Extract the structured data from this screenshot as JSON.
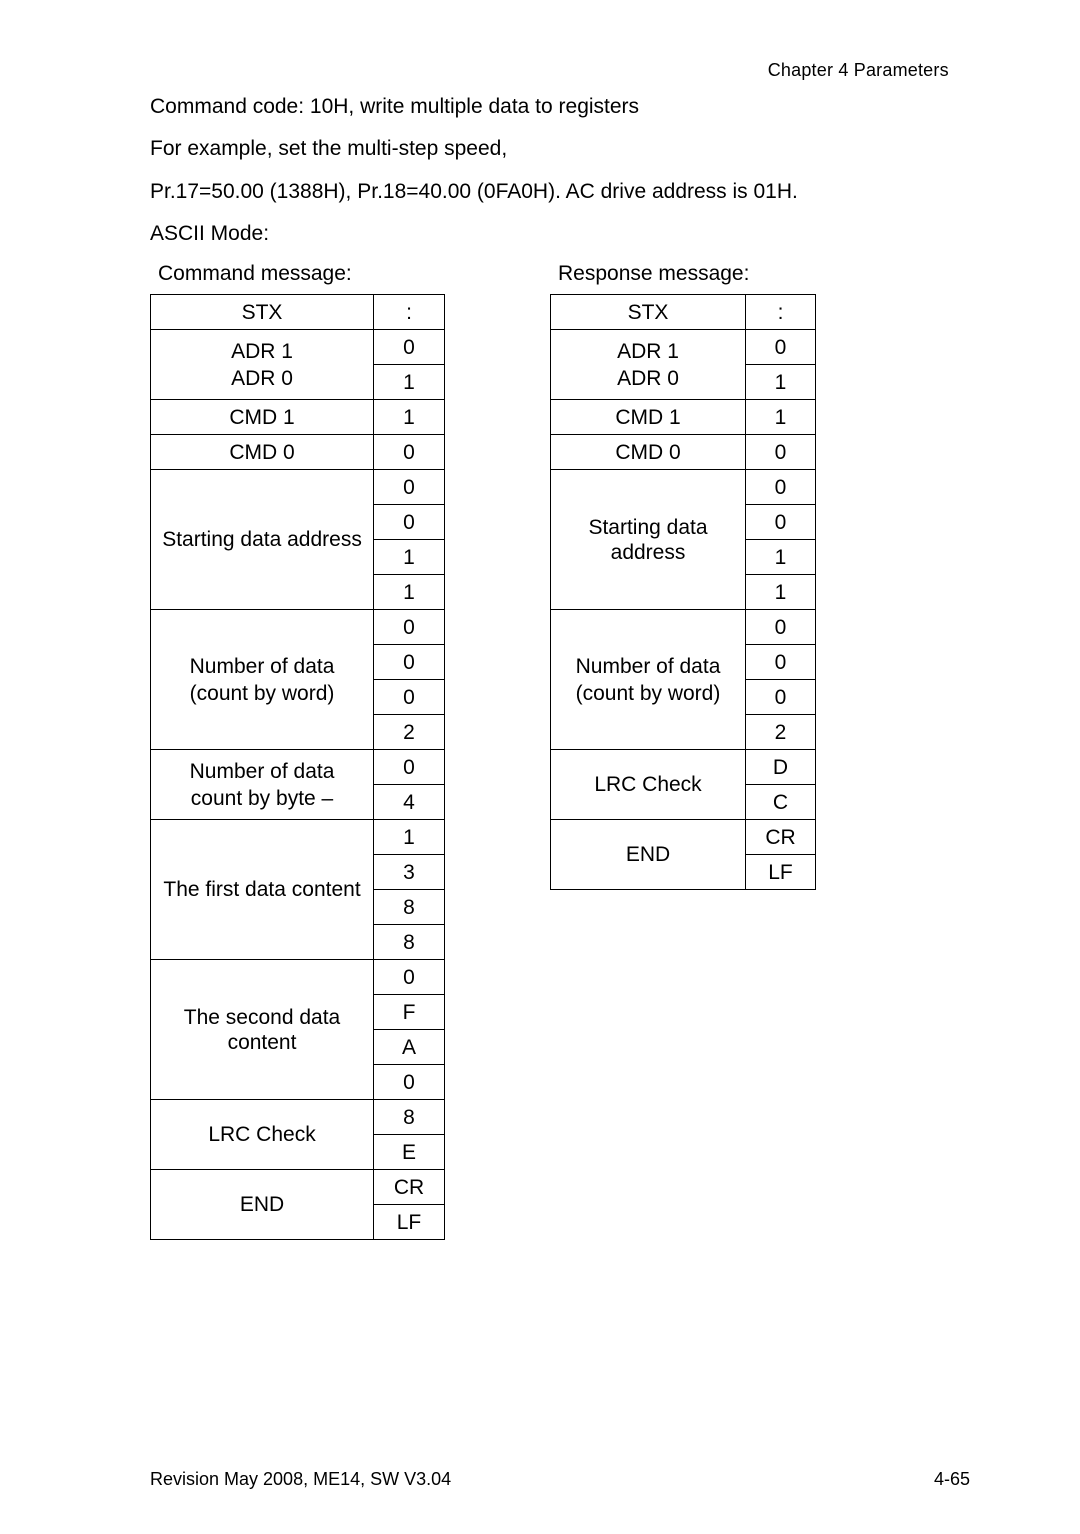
{
  "header": {
    "chapter": "Chapter 4 Parameters "
  },
  "intro": {
    "p1": "Command code: 10H, write multiple data to registers",
    "p2": "For example, set the multi-step speed,",
    "p3": "Pr.17=50.00 (1388H), Pr.18=40.00 (0FA0H). AC drive address is 01H.",
    "p4": "ASCII Mode:"
  },
  "command": {
    "caption": "Command message:",
    "rows": [
      {
        "label": "STX",
        "lines": 1,
        "values": [
          ":"
        ]
      },
      {
        "label": "ADR 1\nADR 0",
        "lines": 2,
        "values": [
          "0",
          "1"
        ]
      },
      {
        "label": "CMD 1",
        "lines": 1,
        "values": [
          "1"
        ]
      },
      {
        "label": "CMD 0",
        "lines": 1,
        "values": [
          "0"
        ]
      },
      {
        "label": "Starting data address",
        "lines": 1,
        "values": [
          "0",
          "0",
          "1",
          "1"
        ]
      },
      {
        "label": "Number of data\n(count by word)",
        "lines": 2,
        "values": [
          "0",
          "0",
          "0",
          "2"
        ]
      },
      {
        "label": "Number of data\ncount by byte –",
        "lines": 2,
        "values": [
          "0",
          "4"
        ]
      },
      {
        "label": "The first data content",
        "lines": 1,
        "values": [
          "1",
          "3",
          "8",
          "8"
        ]
      },
      {
        "label": "The second data content",
        "lines": 1,
        "values": [
          "0",
          "F",
          "A",
          "0"
        ]
      },
      {
        "label": "LRC Check",
        "lines": 1,
        "values": [
          "8",
          "E"
        ]
      },
      {
        "label": "END",
        "lines": 1,
        "values": [
          "CR",
          "LF"
        ]
      }
    ]
  },
  "response": {
    "caption": "Response message:",
    "rows": [
      {
        "label": "STX",
        "lines": 1,
        "values": [
          ":"
        ]
      },
      {
        "label": "ADR 1\nADR 0",
        "lines": 2,
        "values": [
          "0",
          "1"
        ]
      },
      {
        "label": "CMD 1",
        "lines": 1,
        "values": [
          "1"
        ]
      },
      {
        "label": "CMD 0",
        "lines": 1,
        "values": [
          "0"
        ]
      },
      {
        "label": "Starting data address",
        "lines": 1,
        "values": [
          "0",
          "0",
          "1",
          "1"
        ]
      },
      {
        "label": "Number of data\n(count by word)",
        "lines": 2,
        "values": [
          "0",
          "0",
          "0",
          "2"
        ]
      },
      {
        "label": "LRC Check",
        "lines": 1,
        "values": [
          "D",
          "C"
        ]
      },
      {
        "label": "END",
        "lines": 1,
        "values": [
          "CR",
          "LF"
        ]
      }
    ]
  },
  "footer": {
    "left": "Revision May 2008, ME14, SW V3.04",
    "right": "4-65"
  }
}
